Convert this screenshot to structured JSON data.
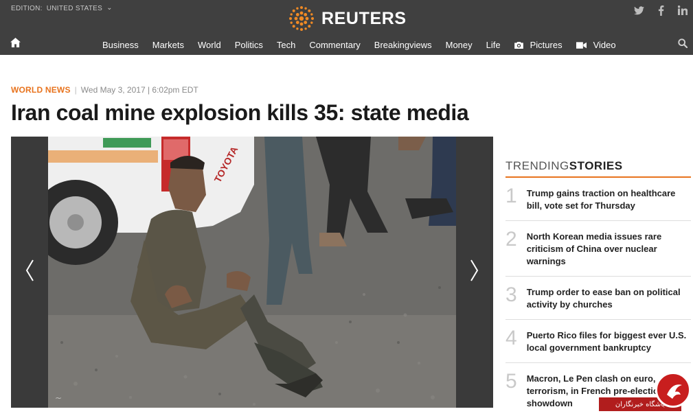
{
  "header": {
    "edition_label": "EDITION:",
    "edition_value": "UNITED STATES",
    "logo_text": "REUTERS",
    "social": [
      "twitter-icon",
      "facebook-icon",
      "linkedin-icon"
    ],
    "nav": [
      {
        "label": "Business"
      },
      {
        "label": "Markets"
      },
      {
        "label": "World"
      },
      {
        "label": "Politics"
      },
      {
        "label": "Tech"
      },
      {
        "label": "Commentary"
      },
      {
        "label": "Breakingviews"
      },
      {
        "label": "Money"
      },
      {
        "label": "Life"
      },
      {
        "label": "Pictures",
        "icon": "camera-icon"
      },
      {
        "label": "Video",
        "icon": "video-icon"
      }
    ]
  },
  "article": {
    "section": "WORLD NEWS",
    "separator": "|",
    "date": "Wed May 3, 2017 | 6:02pm EDT",
    "headline": "Iran coal mine explosion kills 35: state media",
    "photo_vehicle_text": "TOYOTA"
  },
  "trending": {
    "title_light": "TRENDING",
    "title_bold": "STORIES",
    "items": [
      {
        "num": "1",
        "title": "Trump gains traction on healthcare bill, vote set for Thursday"
      },
      {
        "num": "2",
        "title": "North Korean media issues rare criticism of China over nuclear warnings"
      },
      {
        "num": "3",
        "title": "Trump order to ease ban on political activity by churches"
      },
      {
        "num": "4",
        "title": "Puerto Rico files for biggest ever U.S. local government bankruptcy"
      },
      {
        "num": "5",
        "title": "Macron, Le Pen clash on euro, terrorism, in French pre-election showdown"
      }
    ]
  },
  "badge": {
    "text": "باشگاه خبرنگاران"
  },
  "colors": {
    "topbar": "#404040",
    "accent": "#e8731d",
    "headline": "#1a1a1a"
  }
}
